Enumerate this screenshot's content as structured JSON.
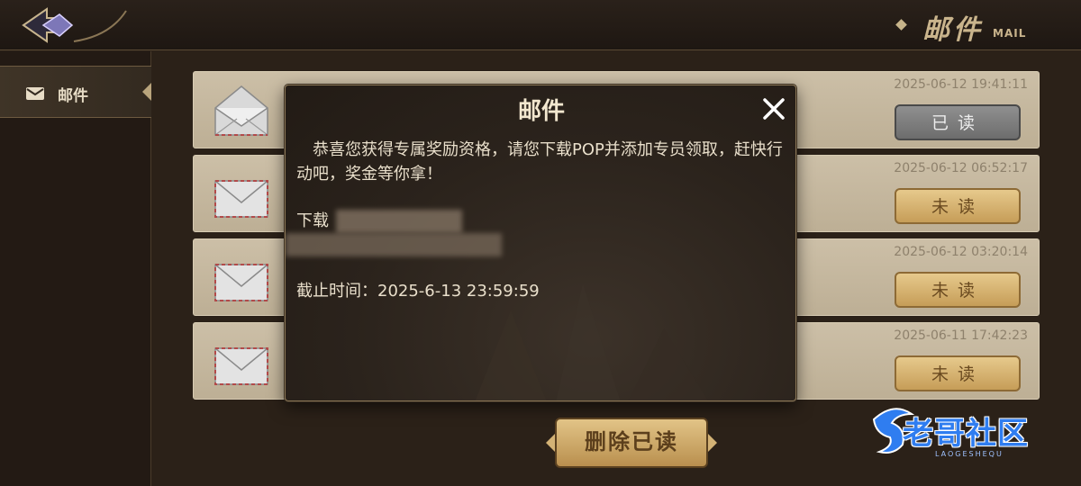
{
  "header": {
    "title_cn": "邮件",
    "title_en": "MAIL"
  },
  "sidebar": {
    "items": [
      {
        "label": "邮件",
        "icon": "mail-icon",
        "selected": true
      }
    ]
  },
  "mails": [
    {
      "date": "2025-06-12 19:41:11",
      "status": "已读",
      "read": true
    },
    {
      "date": "2025-06-12 06:52:17",
      "status": "未读",
      "read": false
    },
    {
      "date": "2025-06-12 03:20:14",
      "status": "未读",
      "read": false
    },
    {
      "date": "2025-06-11 17:42:23",
      "status": "未读",
      "read": false
    }
  ],
  "dialog": {
    "title": "邮件",
    "body": "恭喜您获得专属奖励资格，请您下载POP并添加专员领取，赶快行动吧，奖金等你拿！",
    "download_label": "下载",
    "deadline": "截止时间：2025-6-13  23:59:59"
  },
  "footer": {
    "delete_read_label": "删除已读"
  },
  "watermark": {
    "text": "老哥社区",
    "sub": "LAOGESHEQU"
  },
  "colors": {
    "background": "#2b2118",
    "row_bg": "#c6b99f",
    "read_button": "#7d7d7d",
    "unread_button": "#d6b26f",
    "dialog_bg": "#2b231c",
    "accent_gold": "#c9b48c"
  }
}
